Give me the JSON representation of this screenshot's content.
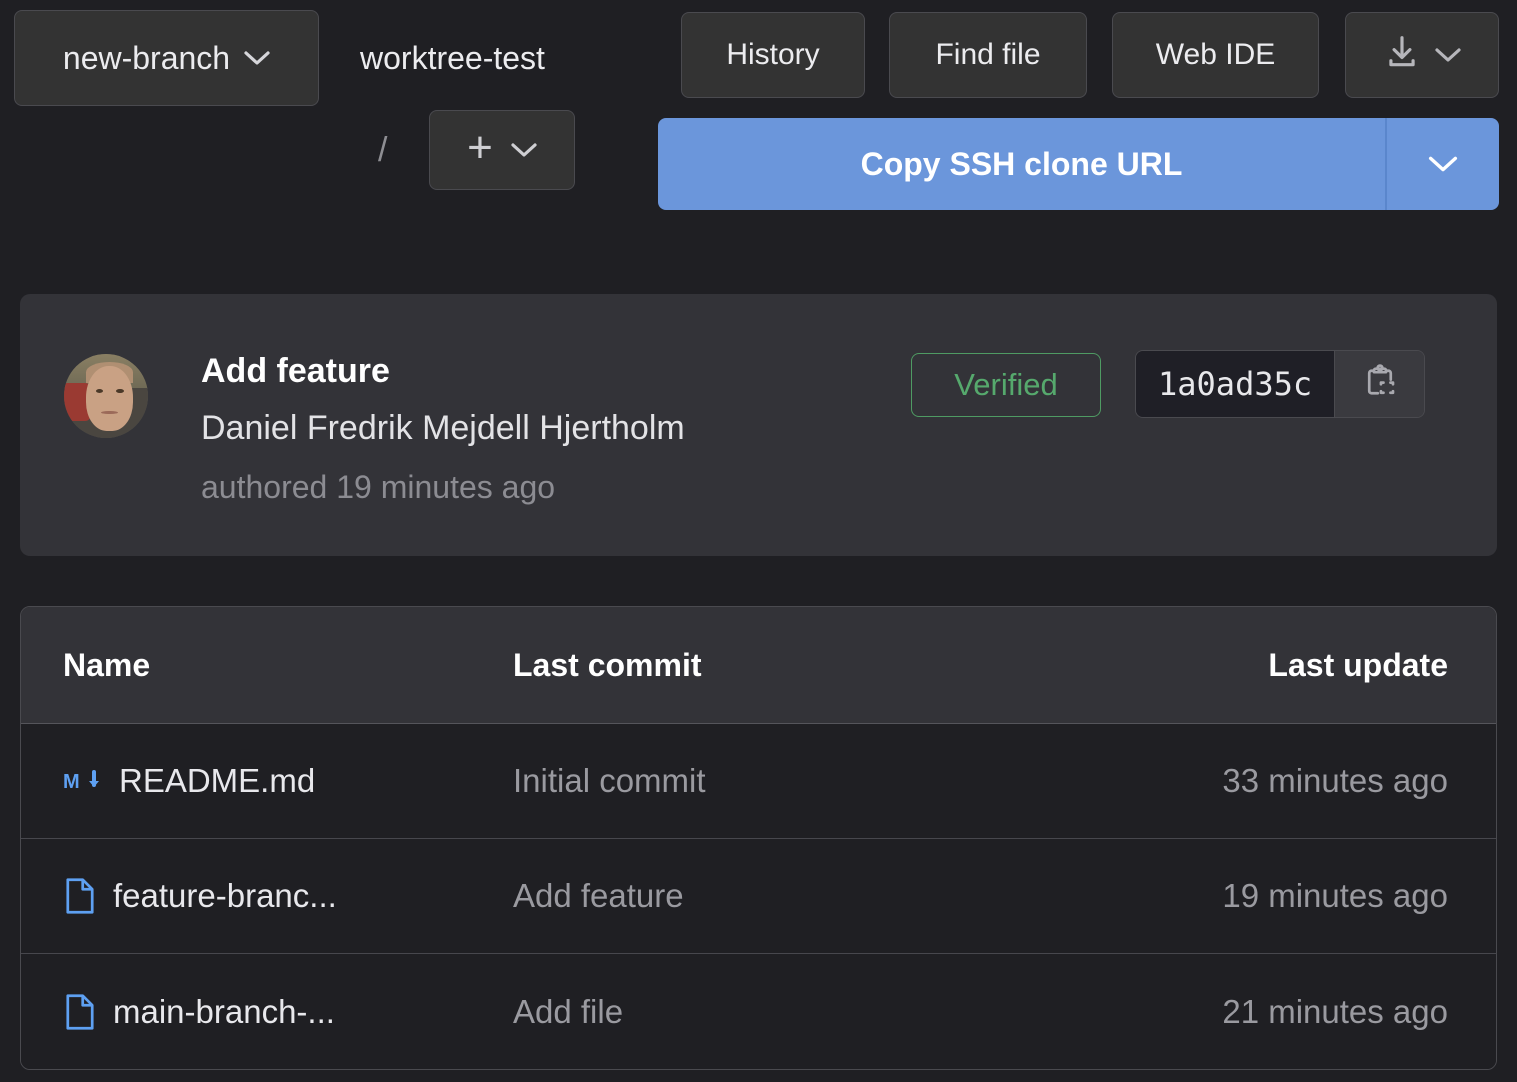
{
  "toolbar": {
    "branch_label": "new-branch",
    "repo_name": "worktree-test",
    "path_separator": "/",
    "add_label": "+",
    "history_label": "History",
    "find_file_label": "Find file",
    "web_ide_label": "Web IDE",
    "download_icon": "download-icon",
    "download_caret_icon": "chevron-down-icon",
    "branch_caret_icon": "chevron-down-icon",
    "add_caret_icon": "chevron-down-icon",
    "clone_label": "Copy SSH clone URL",
    "clone_caret_icon": "chevron-down-icon",
    "clone_color": "#6b96db"
  },
  "commit": {
    "title": "Add feature",
    "author": "Daniel Fredrik Mejdell Hjertholm",
    "authored": "authored 19 minutes ago",
    "verified_label": "Verified",
    "verified_color": "#56a96d",
    "sha": "1a0ad35c",
    "copy_icon": "clipboard-icon",
    "avatar": "avatar"
  },
  "files": {
    "headers": {
      "name": "Name",
      "last_commit": "Last commit",
      "last_update": "Last update"
    },
    "rows": [
      {
        "icon": "markdown-icon",
        "name": "README.md",
        "last_commit": "Initial commit",
        "last_update": "33 minutes ago"
      },
      {
        "icon": "file-icon",
        "name": "feature-branc...",
        "last_commit": "Add feature",
        "last_update": "19 minutes ago"
      },
      {
        "icon": "file-icon",
        "name": "main-branch-...",
        "last_commit": "Add file",
        "last_update": "21 minutes ago"
      }
    ]
  },
  "colors": {
    "background": "#1f1f23",
    "panel": "#333338",
    "border": "#4a4a4f",
    "accent_blue": "#6b96db",
    "file_icon_blue": "#5ea0f2",
    "muted_text": "#9a9aa0"
  }
}
